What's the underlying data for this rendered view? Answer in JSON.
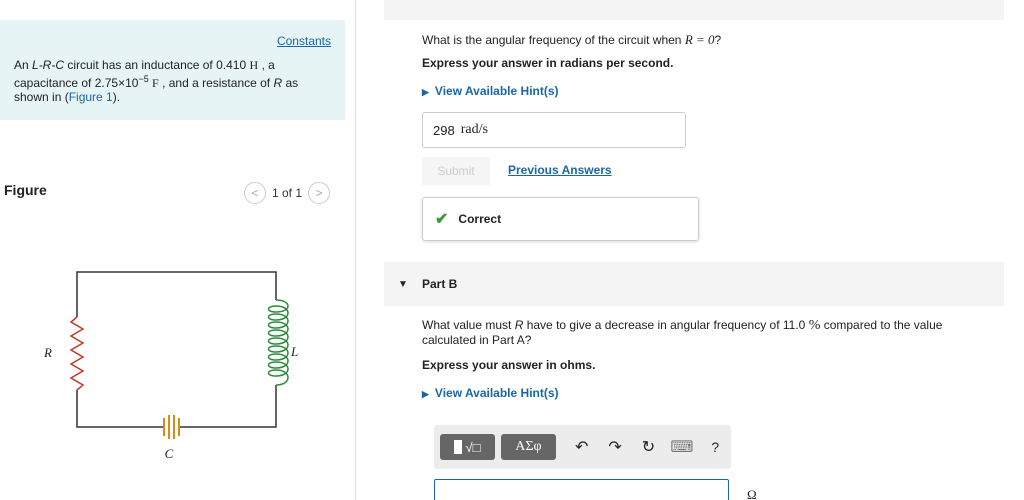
{
  "left": {
    "constants_link": "Constants",
    "problem": {
      "p1": "An ",
      "lrc": "L-R-C",
      "p2": " circuit has an inductance of 0.410 ",
      "unit_H": "H",
      "p3": " , a capacitance of 2.75×10",
      "exp": "−5",
      "unit_F": "F",
      "p4": " , and a resistance of ",
      "R": "R",
      "p5": " as shown in (",
      "figure_link": "Figure 1",
      "p6": ")."
    },
    "figure_label": "Figure",
    "pager": {
      "text": "1 of 1",
      "prev": "<",
      "next": ">"
    },
    "circuit": {
      "R": "R",
      "L": "L",
      "C": "C"
    }
  },
  "partA": {
    "question_pre": "What is the angular frequency of the circuit when ",
    "question_eq": "R = 0",
    "question_post": "?",
    "instruction": "Express your answer in radians per second.",
    "hint": "View Available Hint(s)",
    "answer_value": "298",
    "answer_unit": "rad/s",
    "submit": "Submit",
    "previous_answers": "Previous Answers",
    "feedback": "Correct"
  },
  "partB": {
    "title": "Part B",
    "question_pre": "What value must ",
    "question_R": "R",
    "question_mid": " have to give a decrease in angular frequency of 11.0 ",
    "question_pct": "%",
    "question_post": " compared to the value calculated in Part A?",
    "instruction": "Express your answer in ohms.",
    "hint": "View Available Hint(s)",
    "toolbar": {
      "templates": "√□",
      "greek": "ΑΣφ",
      "undo": "↶",
      "redo": "↷",
      "reset": "↻",
      "keyboard": "⌨",
      "help": "?"
    },
    "unit": "Ω"
  },
  "colors": {
    "link": "#1a66a8",
    "constants_bg": "#e6f4f6",
    "correct_check": "#3a9a36",
    "toolbar_btn": "#666666"
  }
}
